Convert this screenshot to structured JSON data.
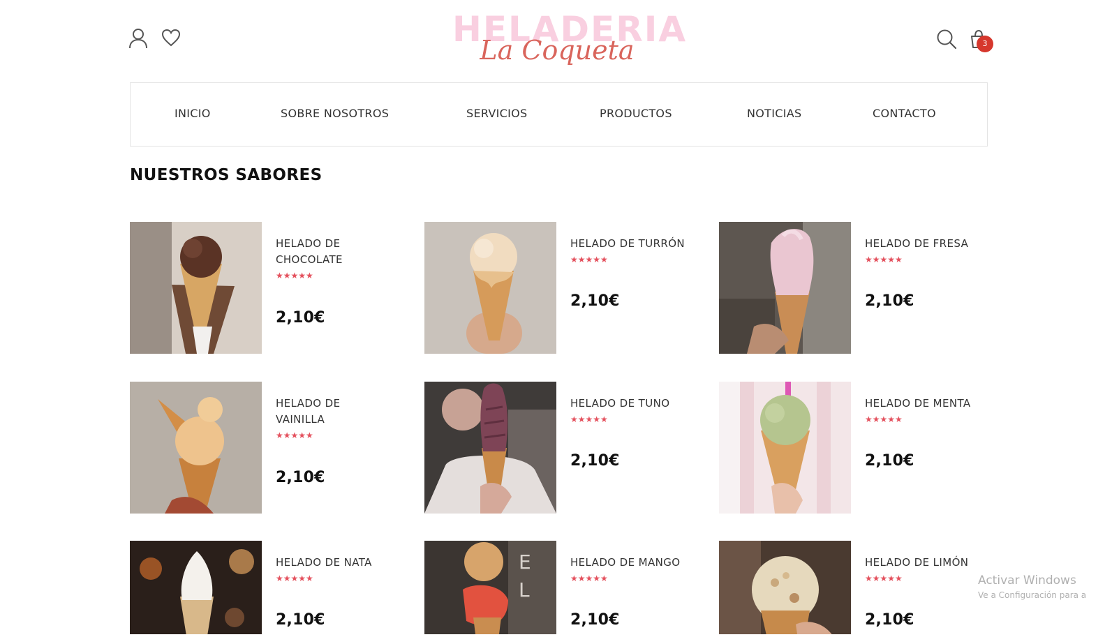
{
  "brand": {
    "line1": "HELADERIA",
    "line2": "La Coqueta"
  },
  "header_icons": {
    "account": "user-icon",
    "wishlist": "heart-icon",
    "search": "search-icon",
    "cart": "shopping-bag-icon",
    "cart_count": "3"
  },
  "nav": {
    "items": [
      {
        "label": "INICIO"
      },
      {
        "label": "SOBRE NOSOTROS"
      },
      {
        "label": "SERVICIOS"
      },
      {
        "label": "PRODUCTOS"
      },
      {
        "label": "NOTICIAS"
      },
      {
        "label": "CONTACTO"
      }
    ]
  },
  "section": {
    "title": "NUESTROS SABORES"
  },
  "products": [
    {
      "name_lines": [
        "HELADO DE",
        "CHOCOLATE"
      ],
      "rating": 5,
      "stars": "★★★★★",
      "price": "2,10€"
    },
    {
      "name_lines": [
        "HELADO DE TURRÓN"
      ],
      "rating": 5,
      "stars": "★★★★★",
      "price": "2,10€"
    },
    {
      "name_lines": [
        "HELADO DE FRESA"
      ],
      "rating": 5,
      "stars": "★★★★★",
      "price": "2,10€"
    },
    {
      "name_lines": [
        "HELADO DE",
        "VAINILLA"
      ],
      "rating": 5,
      "stars": "★★★★★",
      "price": "2,10€"
    },
    {
      "name_lines": [
        "HELADO DE TUNO"
      ],
      "rating": 5,
      "stars": "★★★★★",
      "price": "2,10€"
    },
    {
      "name_lines": [
        "HELADO DE MENTA"
      ],
      "rating": 5,
      "stars": "★★★★★",
      "price": "2,10€"
    },
    {
      "name_lines": [
        "HELADO DE NATA"
      ],
      "rating": 5,
      "stars": "★★★★★",
      "price": "2,10€"
    },
    {
      "name_lines": [
        "HELADO DE MANGO"
      ],
      "rating": 5,
      "stars": "★★★★★",
      "price": "2,10€"
    },
    {
      "name_lines": [
        "HELADO DE LIMÓN"
      ],
      "rating": 5,
      "stars": "★★★★★",
      "price": "2,10€"
    }
  ],
  "colors": {
    "accent_star": "#e4505d",
    "badge": "#d6372d",
    "logo_pink": "#f9cfe0",
    "logo_coral": "#d9655c"
  },
  "watermark": {
    "line1": "Activar Windows",
    "line2": "Ve a Configuración para a"
  }
}
